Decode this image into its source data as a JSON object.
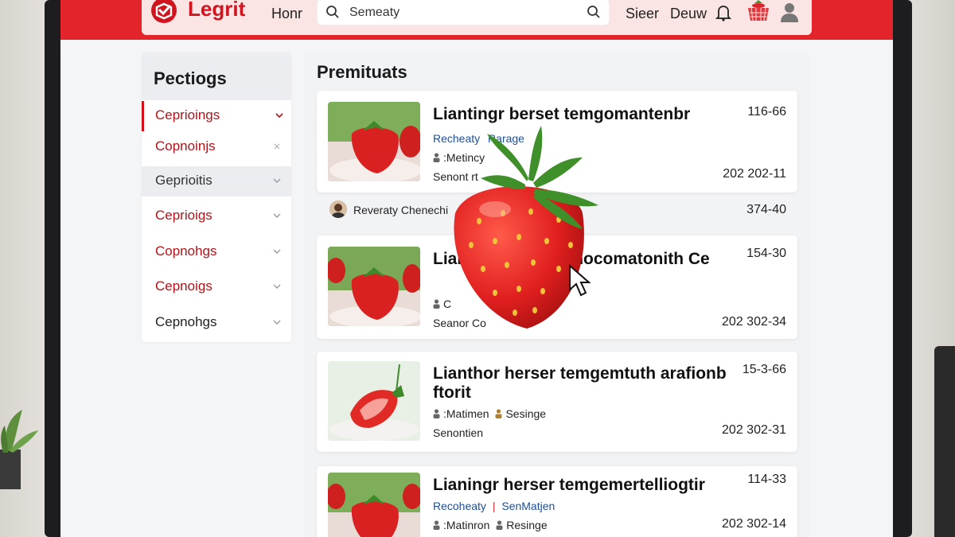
{
  "app": {
    "brand": "Legrit"
  },
  "nav": {
    "home": "Honr",
    "sign": "Sieer",
    "deuw": "Deuw"
  },
  "search": {
    "value": "Semeaty"
  },
  "icons": {
    "logo": "logo-icon",
    "search": "search-icon",
    "bell": "bell-icon",
    "cart": "basket-icon",
    "user": "user-icon",
    "chevron": "chevron-down-icon",
    "close": "close-icon",
    "cursor": "cursor-icon"
  },
  "colors": {
    "brand_red": "#e3242b",
    "header_bg": "#fbe4e4",
    "link_blue": "#1d4f9a",
    "panel": "#f2f3f5"
  },
  "sidebar": {
    "title": "Pectiogs",
    "items": [
      {
        "label": "Ceprioings",
        "state": "active"
      },
      {
        "label": "Copnoinjs",
        "state": "close"
      },
      {
        "label": "Geprioitis",
        "state": "hover"
      },
      {
        "label": "Ceprioigs",
        "state": "normal"
      },
      {
        "label": "Copnohgs",
        "state": "normal"
      },
      {
        "label": "Cepnoigs",
        "state": "normal"
      },
      {
        "label": "Cepnohgs",
        "state": "dark"
      }
    ]
  },
  "main": {
    "title": "Premituats",
    "cards": [
      {
        "title": "Liantingr berset temgomantenbr",
        "meta1": "Recheaty",
        "meta1b": "Rarage",
        "meta2": ":Metincy",
        "meta3": "Senont rt",
        "num": "116-66",
        "date": "202 202-11"
      },
      {
        "title": "Lianting dacecce  nocomatonith Ce",
        "meta1": "",
        "meta2": "C",
        "meta2b": "raga",
        "meta3": "Seanor Co",
        "num": "154-30",
        "date": "202 302-34"
      },
      {
        "title": "Lianthor herser temgemtuth arafionb ftorit",
        "meta1": "",
        "meta2": ":Matimen",
        "meta2b": "Sesinge",
        "meta3": "Senontien",
        "num": "15-3-66",
        "date": "202 302-31"
      },
      {
        "title": "Lianingr herser temgemertelliogtir",
        "meta1": "Recoheaty",
        "meta1b": "SenMatjen",
        "meta2": ":Matinron",
        "meta2b": "Resinge",
        "meta3": "",
        "num": "114-33",
        "date": "202 302-14"
      }
    ],
    "row": {
      "name": "Reveraty Chenechi",
      "num": "374-40"
    }
  }
}
